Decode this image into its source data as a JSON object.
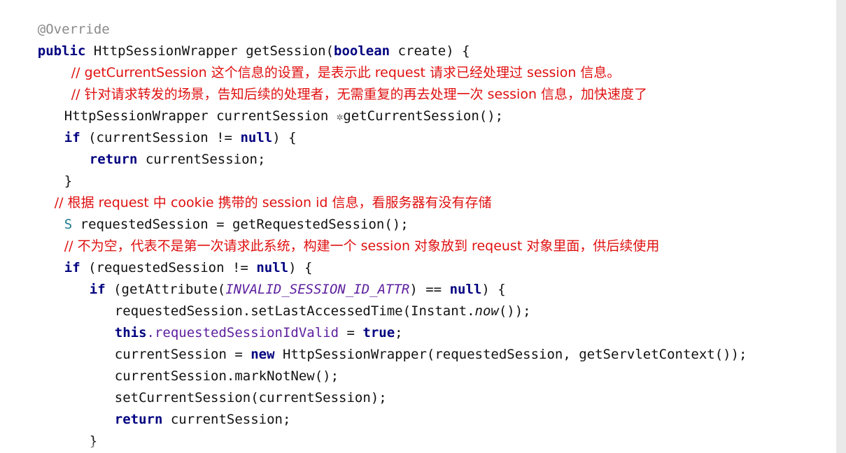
{
  "code": {
    "annotation": "@Override",
    "sig_kw": "public",
    "sig_rest": "HttpSessionWrapper getSession(",
    "sig_bool": "boolean",
    "sig_end": "create) {",
    "comment1": "// getCurrentSession 这个信息的设置，是表示此 request 请求已经处理过 session 信息。",
    "comment2": "// 针对请求转发的场景，告知后续的处理者，无需重复的再去处理一次 session 信息，加快速度了",
    "line_current_a": "HttpSessionWrapper currentSession ",
    "line_current_b": "getCurrentSession();",
    "if1_kw": "if",
    "if1_a": " (currentSession != ",
    "if1_null": "null",
    "if1_b": ") {",
    "ret1_kw": "return",
    "ret1_rest": " currentSession;",
    "close1": "}",
    "comment3": "// 根据 request 中 cookie 携带的 session id 信息，看服务器有没有存储",
    "req_badge": "S",
    "req_rest": " requestedSession = getRequestedSession();",
    "comment4": "// 不为空，代表不是第一次请求此系统，构建一个 session 对象放到 reqeust 对象里面，供后续使用",
    "if2_kw": "if",
    "if2_a": " (requestedSession != ",
    "if2_null": "null",
    "if2_b": ") {",
    "if3_kw": "if",
    "if3_a": " (getAttribute(",
    "if3_const": "INVALID_SESSION_ID_ATTR",
    "if3_b": ") == ",
    "if3_null": "null",
    "if3_c": ") {",
    "set_time_a": "requestedSession.setLastAccessedTime(Instant.",
    "set_time_now": "now",
    "set_time_b": "());",
    "this_kw": "this",
    "this_fld": ".requestedSessionIdValid",
    "this_eq": " = ",
    "this_true": "true",
    "this_end": ";",
    "new_a": "currentSession = ",
    "new_kw": "new",
    "new_b": " HttpSessionWrapper(requestedSession, getServletContext());",
    "mark": "currentSession.markNotNew();",
    "setcur": "setCurrentSession(currentSession);",
    "ret2_kw": "return",
    "ret2_rest": " currentSession;",
    "close3": "}",
    "close2": "}"
  },
  "icons": {
    "current_marker": "gear-icon"
  },
  "colors": {
    "keyword": "#000080",
    "comment": "#e01010",
    "annotation": "#8a8a8a",
    "field": "#5c1e9e",
    "background": "#ffffff"
  }
}
